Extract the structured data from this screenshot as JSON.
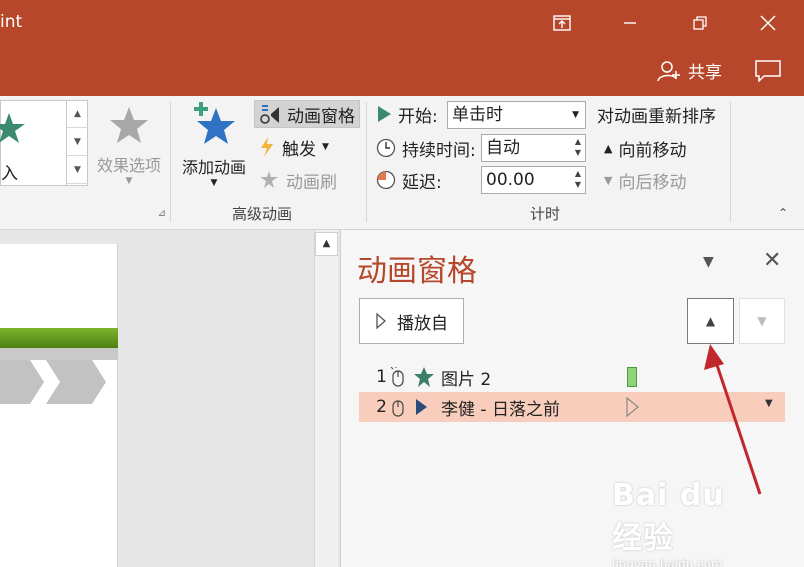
{
  "titlebar": {
    "app_title_fragment": "int",
    "share_label": "共享"
  },
  "ribbon": {
    "animation_gallery_partial_label": "入",
    "effect_options_label": "效果选项",
    "add_animation_label": "添加动画",
    "animation_pane_label": "动画窗格",
    "trigger_label": "触发",
    "animation_painter_label": "动画刷",
    "advanced_animation_group": "高级动画",
    "start_label": "开始:",
    "start_value": "单击时",
    "duration_label": "持续时间:",
    "duration_value": "自动",
    "delay_label": "延迟:",
    "delay_value": "00.00",
    "timing_group": "计时",
    "reorder_label": "对动画重新排序",
    "move_earlier_label": "向前移动",
    "move_later_label": "向后移动"
  },
  "pane": {
    "title": "动画窗格",
    "play_from_label": "播放自",
    "items": [
      {
        "number": "1",
        "name": "图片 2",
        "type": "emphasis",
        "selected": false
      },
      {
        "number": "2",
        "name": "李健 - 日落之前",
        "type": "media",
        "selected": true
      }
    ]
  },
  "watermark": {
    "logo": "Bai du 经验",
    "url": "jingyan.baidu.com"
  },
  "colors": {
    "accent": "#b7472a",
    "selected_row": "#f8cdbb",
    "emphasis_star": "#3d7f6a",
    "timing_bar": "#8fd47a",
    "arrow": "#c0282d"
  }
}
